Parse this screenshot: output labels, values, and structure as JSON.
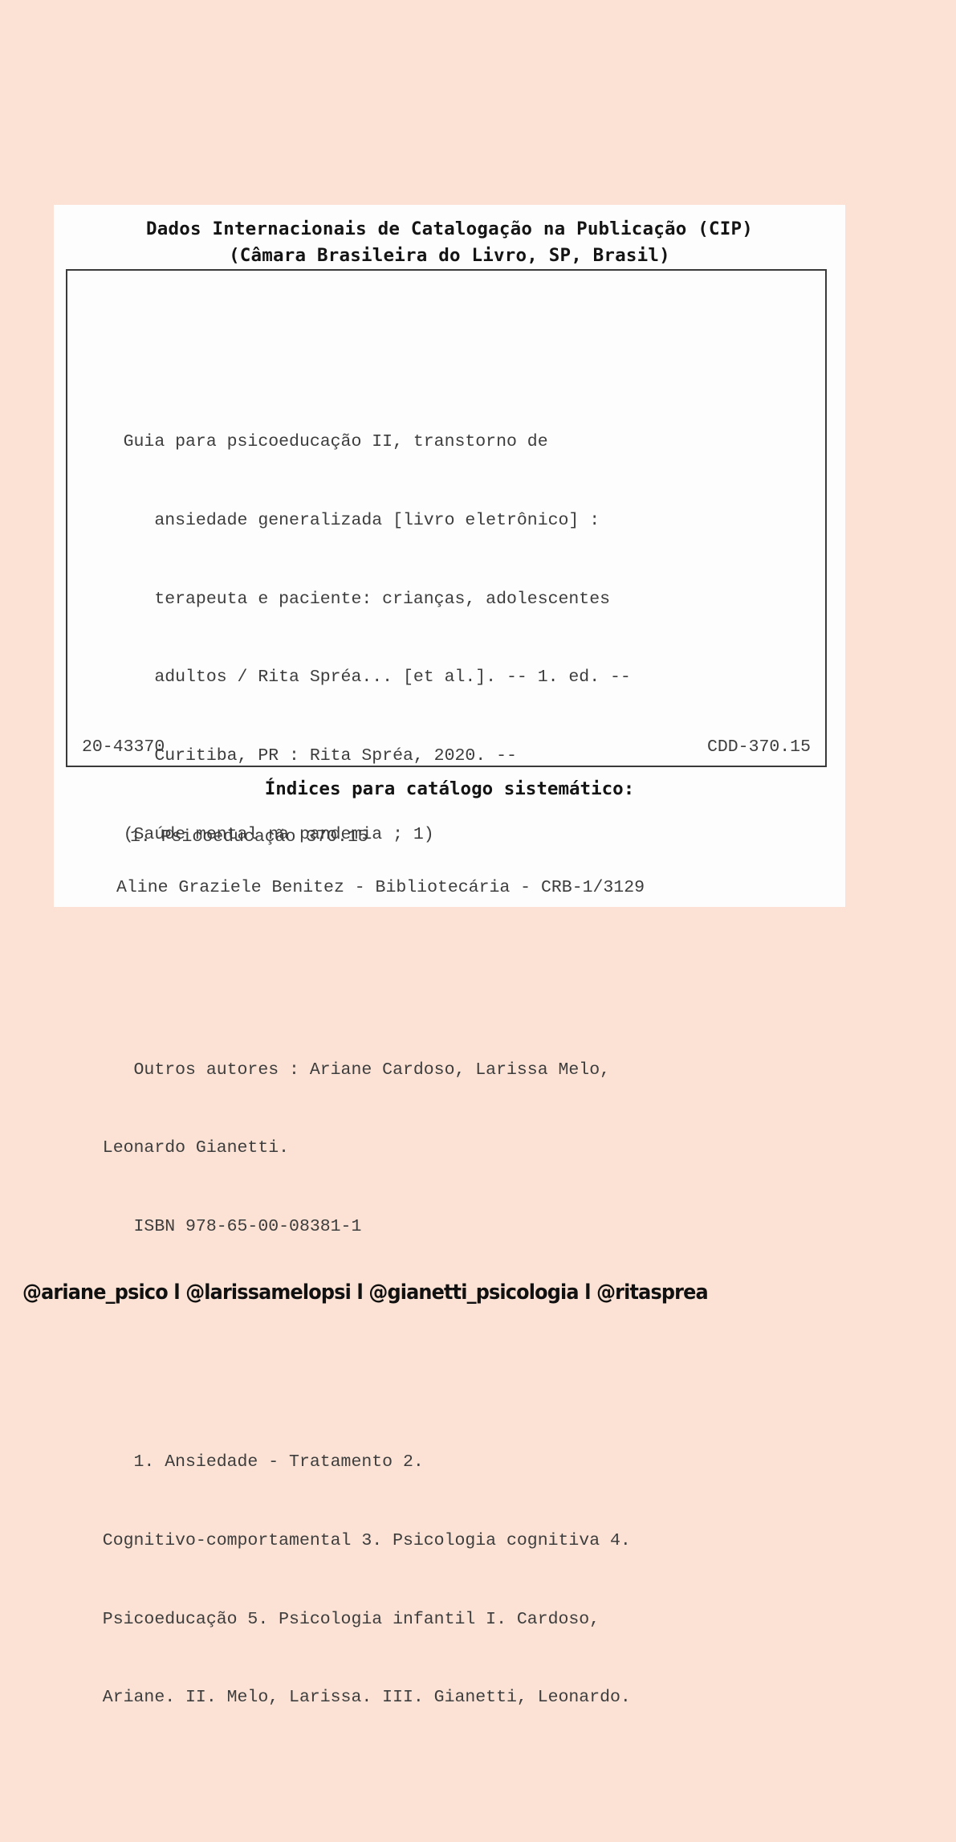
{
  "page": {
    "background_color": "#fce2d4",
    "sheet_color": "#fdfdfd",
    "text_color": "#3d3d3d",
    "heading_color": "#141414",
    "box_border_color": "#3a3a3a"
  },
  "heading": {
    "line_1": "Dados Internacionais de Catalogação na Publicação (CIP)",
    "line_2": "(Câmara Brasileira do Livro, SP, Brasil)"
  },
  "record": {
    "title_block": {
      "lines": [
        "    Guia para psicoeducação II, transtorno de",
        "       ansiedade generalizada [livro eletrônico] :",
        "       terapeuta e paciente: crianças, adolescentes",
        "       adultos / Rita Spréa... [et al.]. -- 1. ed. --",
        "       Curitiba, PR : Rita Spréa, 2020. --",
        "    (Saúde mental na pandemia ; 1)"
      ]
    },
    "authors_block": {
      "lines": [
        "     Outros autores : Ariane Cardoso, Larissa Melo,",
        "  Leonardo Gianetti.",
        "     ISBN 978-65-00-08381-1"
      ]
    },
    "subjects_block": {
      "lines": [
        "     1. Ansiedade - Tratamento 2.",
        "  Cognitivo-comportamental 3. Psicologia cognitiva 4.",
        "  Psicoeducação 5. Psicologia infantil I. Cardoso,",
        "  Ariane. II. Melo, Larissa. III. Gianetti, Leonardo."
      ]
    },
    "control_number": "20-43370",
    "cdd": "CDD-370.15"
  },
  "indices": {
    "title": "Índices para catálogo sistemático:",
    "entry": "1. Psicoeducação 370.15"
  },
  "librarian": {
    "credit": "Aline Graziele Benitez - Bibliotecária - CRB-1/3129"
  },
  "footer": {
    "handles": "@ariane_psico l @larissamelopsi l @gianetti_psicologia l @ritasprea"
  }
}
